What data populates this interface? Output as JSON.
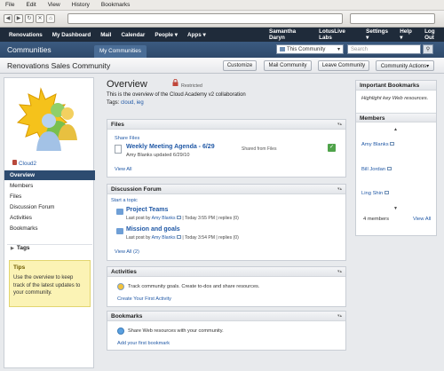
{
  "browser_menu": [
    "File",
    "Edit",
    "View",
    "History",
    "Bookmarks"
  ],
  "topnav": {
    "left": [
      "Renovations",
      "My Dashboard",
      "Mail",
      "Calendar",
      "People ▾",
      "Apps ▾"
    ],
    "user": "Samantha Daryn",
    "org": "LotusLive Labs",
    "settings": "Settings ▾",
    "help": "Help ▾",
    "logout": "Log Out"
  },
  "secnav": {
    "title": "Communities",
    "tab": "My Communities",
    "scope": "This Community",
    "search_placeholder": "Search"
  },
  "header": {
    "title": "Renovations Sales Community",
    "buttons": [
      "Customize",
      "Mail Community",
      "Leave Community",
      "Community Actions▾"
    ]
  },
  "left": {
    "cloud_link": "Cloud2",
    "nav": [
      "Overview",
      "Members",
      "Files",
      "Discussion Forum",
      "Activities",
      "Bookmarks"
    ],
    "tags_label": "Tags",
    "tips_title": "Tips",
    "tips_text": "Use the overview to keep track of the latest updates to your community."
  },
  "overview": {
    "title": "Overview",
    "restricted": "Restricted",
    "description": "This is the overview of the Cloud Academy v2 collaboration",
    "tags_label": "Tags:",
    "tags": "cloud, ieg"
  },
  "files": {
    "title": "Files",
    "share": "Share Files",
    "item_title": "Weekly Meeting Agenda - 6/29",
    "item_shared": "Shared from Files",
    "item_meta": "Amy Blanks updated 6/29/10",
    "view_all": "View All"
  },
  "forum": {
    "title": "Discussion Forum",
    "start": "Start a topic",
    "topics": [
      {
        "title": "Project Teams",
        "meta_prefix": "Last post by",
        "author": "Amy Blanks",
        "time": "Today 3:55 PM",
        "replies": "replies (0)"
      },
      {
        "title": "Mission and goals",
        "meta_prefix": "Last post by",
        "author": "Amy Blanks",
        "time": "Today 3:54 PM",
        "replies": "replies (0)"
      }
    ],
    "view_all": "View All (2)"
  },
  "activities": {
    "title": "Activities",
    "text": "Track community goals. Create to-dos and share resources.",
    "link": "Create Your First Activity"
  },
  "bookmarks": {
    "title": "Bookmarks",
    "text": "Share Web resources with your community.",
    "link": "Add your first bookmark"
  },
  "right": {
    "imp_title": "Important Bookmarks",
    "imp_text": "Highlight key Web resources.",
    "members_title": "Members",
    "members": [
      "Amy Blanks",
      "Bill Jordan",
      "Ling Shin"
    ],
    "count": "4 members",
    "view_all": "View All"
  }
}
